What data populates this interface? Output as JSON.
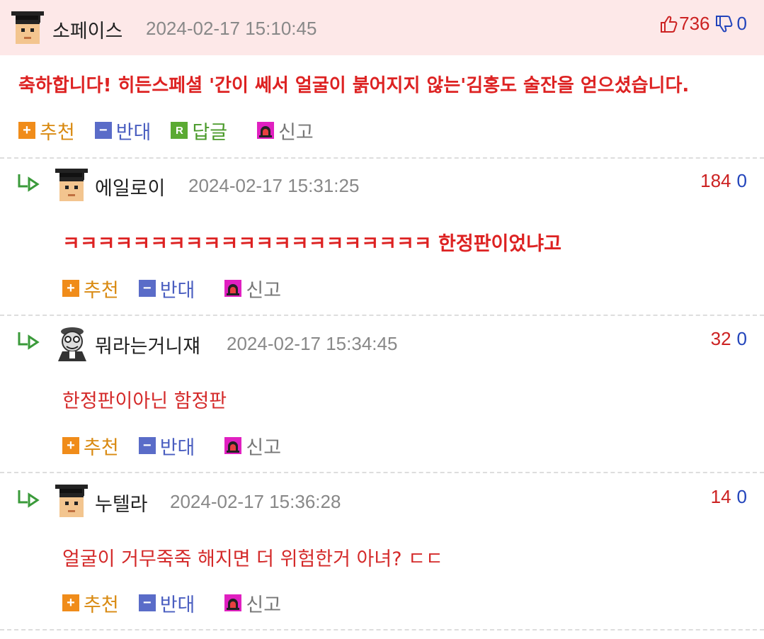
{
  "comments": [
    {
      "nick": "소페이스",
      "date": "2024-02-17 15:10:45",
      "up": "736",
      "down": "0",
      "text": "축하합니다! 히든스페셜 '간이 쎄서 얼굴이 붉어지지 않는'김홍도 술잔을 얻으셨습니다.",
      "highlighted": true
    },
    {
      "nick": "에일로이",
      "date": "2024-02-17 15:31:25",
      "up": "184",
      "down": "0",
      "text": "ㅋㅋㅋㅋㅋㅋㅋㅋㅋㅋㅋㅋㅋㅋㅋㅋㅋㅋㅋㅋㅋ 한정판이었냐고"
    },
    {
      "nick": "뭐라는거니쟤",
      "date": "2024-02-17 15:34:45",
      "up": "32",
      "down": "0",
      "text": "한정판이아닌 함정판"
    },
    {
      "nick": "누텔라",
      "date": "2024-02-17 15:36:28",
      "up": "14",
      "down": "0",
      "text": "얼굴이 거무죽죽 해지면 더 위험한거 아녀? ㄷㄷ"
    }
  ],
  "actions": {
    "recommend": "추천",
    "oppose": "반대",
    "reply": "답글",
    "report": "신고",
    "recommend_icon": "+",
    "oppose_icon": "−",
    "reply_icon": "R"
  },
  "colors": {
    "highlight_bg": "#fde8e8",
    "comment_text": "#d42a2a",
    "up_count": "#cc2222",
    "down_count": "#2244bb"
  },
  "icons": [
    "graduate-avatar-icon",
    "cartoon-avatar-icon",
    "reply-arrow-icon",
    "thumbs-up-icon",
    "thumbs-down-icon",
    "siren-icon"
  ]
}
